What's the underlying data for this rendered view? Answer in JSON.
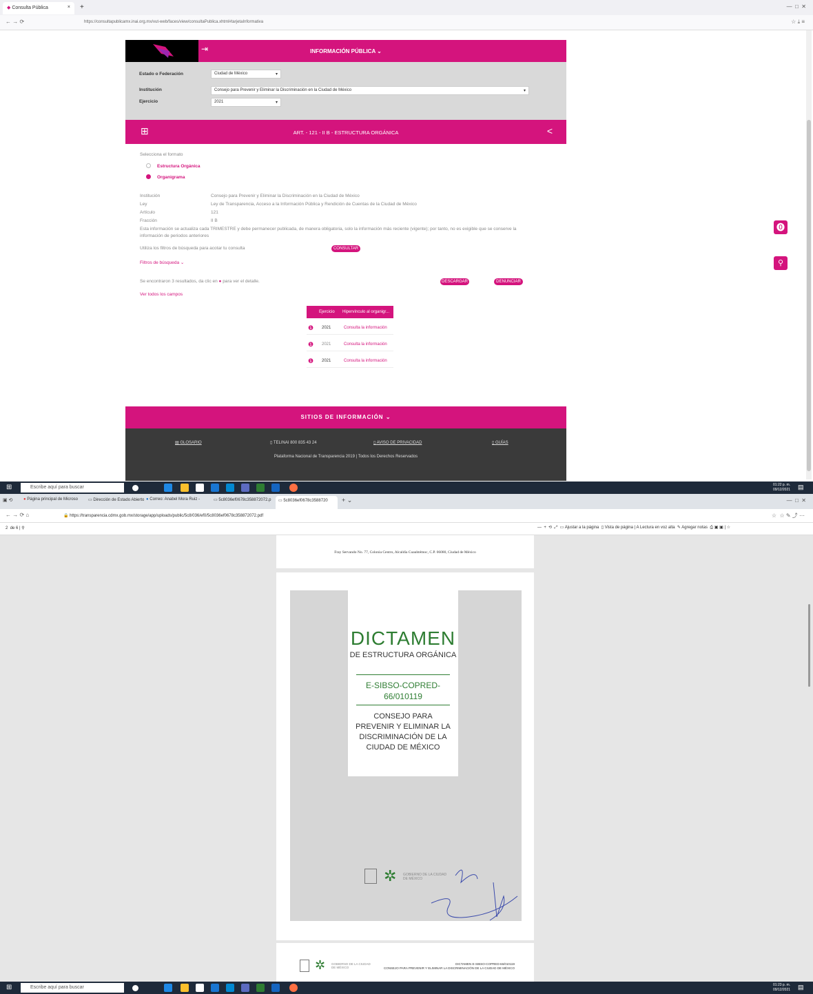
{
  "top": {
    "tab_title": "Consulta Pública",
    "url": "https://consultapublicamx.inai.org.mx/vut-web/faces/view/consultaPublica.xhtml#tarjetaInformativa",
    "header_title": "INFORMACIÓN PÚBLICA",
    "filters": {
      "state_label": "Estado o Federación",
      "state_value": "Ciudad de México",
      "institution_label": "Institución",
      "institution_value": "Consejo para Prevenir y Eliminar la Discriminación en la Ciudad de México",
      "year_label": "Ejercicio",
      "year_value": "2021"
    },
    "article_title": "ART. - 121 - II B - ESTRUCTURA ORGÁNICA",
    "format_label": "Selecciona el formato",
    "option1": "Estructura Orgánica",
    "option2": "Organigrama",
    "info": {
      "institucion_k": "Institución",
      "institucion_v": "Consejo para Prevenir y Eliminar la Discriminación en la Ciudad de México",
      "ley_k": "Ley",
      "ley_v": "Ley de Transparencia, Acceso a la Información Pública y Rendición de Cuentas de la Ciudad de México",
      "articulo_k": "Artículo",
      "articulo_v": "121",
      "fraccion_k": "Fracción",
      "fraccion_v": "II B"
    },
    "notice": "Esta información se actualiza cada TRIMESTRE y debe permanecer publicada, de manera obligatoria, solo la información más reciente (vigente); por tanto, no es exigible que se conserve la información de periodos anteriores",
    "filters_hint": "Utiliza los filtros de búsqueda para acotar tu consulta",
    "consultar": "CONSULTAR",
    "filtros_link": "Filtros de búsqueda",
    "results_text": "Se encontraron 3 resultados, da clic en",
    "results_text2": "para ver el detalle.",
    "descargar": "DESCARGAR",
    "denunciar": "DENUNCIAR",
    "ver_todos": "Ver todos los campos",
    "table": {
      "headers": [
        "Ejercicio",
        "Hipervínculo al organigr..."
      ],
      "rows": [
        {
          "year": "2021",
          "link": "Consulta la información"
        },
        {
          "year": "2021",
          "link": "Consulta la información"
        },
        {
          "year": "2021",
          "link": "Consulta la información"
        }
      ]
    },
    "footer_title": "SITIOS DE INFORMACIÓN",
    "footer_links": [
      "GLOSARIO",
      "TELINAI 800 835 43 24",
      "AVISO DE PRIVACIDAD",
      "GUÍAS"
    ],
    "footer_copy": "Plataforma Nacional de Transparencia 2019 | Todos los Derechos Reservados",
    "taskbar_search": "Escribe aquí para buscar",
    "clock_time": "01:22 p. m.",
    "clock_date": "09/12/2021"
  },
  "bottom": {
    "tabs": [
      "Página principal de Microso",
      "Dirección de Estado Abierto",
      "Correo: Anabel Mora Ruiz -",
      "5c8036ef0678c358872072.p",
      "5c8036ef0678c3588720"
    ],
    "url": "https://transparencia.cdmx.gob.mx/storage/app/uploads/public/5c8/036/ef0/5c8036ef0678c358872072.pdf",
    "page_indicator": "2",
    "page_of": "de 6",
    "toolbar": [
      "Ajustar a la página",
      "Vista de página",
      "Lectura en voz alta",
      "Agregar notas"
    ],
    "prev_page_text": "Fray Servando No. 77, Colonia Centro, Alcaldía Cuauhtémoc, C.P. 06080, Ciudad de México",
    "doc": {
      "title": "DICTAMEN",
      "subtitle": "DE ESTRUCTURA ORGÁNICA",
      "code": "E-SIBSO-COPRED-66/010119",
      "org": "CONSEJO PARA PREVENIR Y ELIMINAR LA DISCRIMINACIÓN DE LA CIUDAD DE MÉXICO",
      "gov_label": "GOBIERNO DE LA CIUDAD DE MÉXICO"
    },
    "footer_doc_code": "DICTAMEN E-SIBSO-COPRED-66/010119",
    "footer_doc_org": "CONSEJO PARA PREVENIR Y ELIMINAR LA DISCRIMINACIÓN DE LA CIUDAD DE MÉXICO",
    "taskbar_search": "Escribe aquí para buscar",
    "clock_time": "01:23 p. m.",
    "clock_date": "09/12/2021"
  },
  "colors": {
    "accent": "#d4147d",
    "green": "#2e7d32",
    "dark": "#333333"
  }
}
